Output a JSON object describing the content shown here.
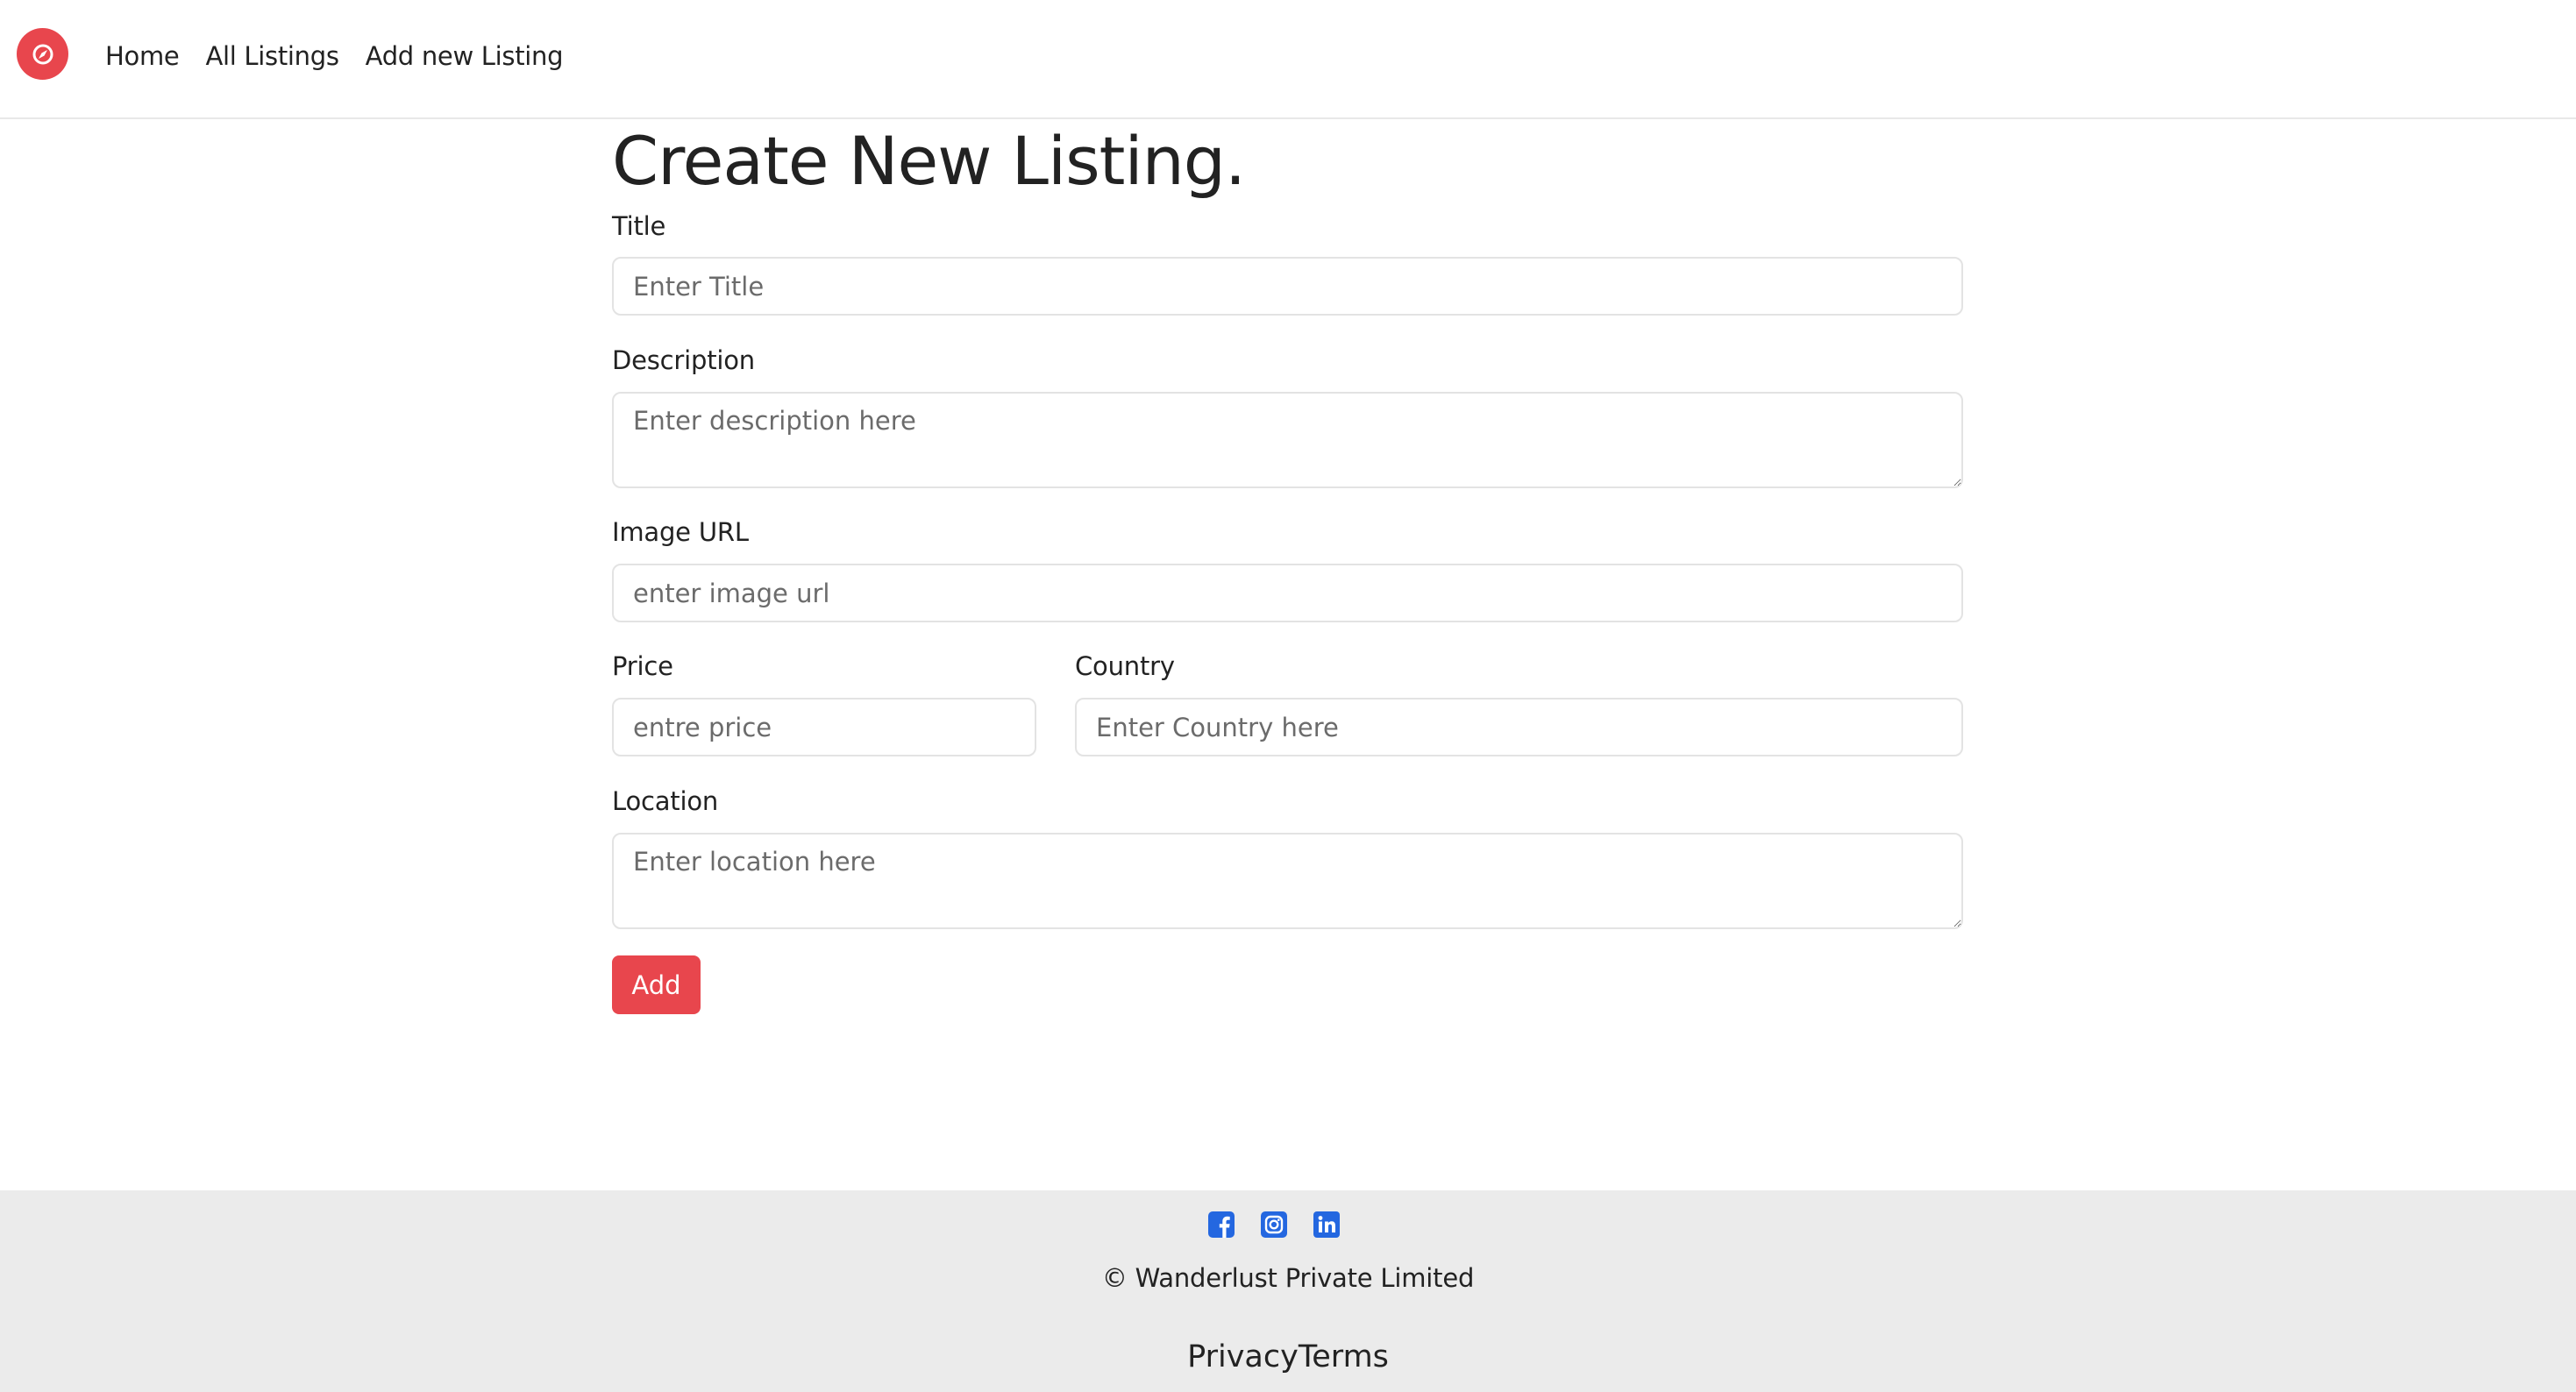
{
  "nav": {
    "logo_icon": "compass-icon",
    "links": [
      {
        "label": "Home"
      },
      {
        "label": "All Listings"
      },
      {
        "label": "Add new Listing"
      }
    ]
  },
  "form": {
    "title": "Create New Listing.",
    "fields": {
      "title": {
        "label": "Title",
        "placeholder": "Enter Title",
        "value": ""
      },
      "description": {
        "label": "Description",
        "placeholder": "Enter description here",
        "value": ""
      },
      "image_url": {
        "label": "Image URL",
        "placeholder": "enter image url",
        "value": ""
      },
      "price": {
        "label": "Price",
        "placeholder": "entre price",
        "value": ""
      },
      "country": {
        "label": "Country",
        "placeholder": "Enter Country here",
        "value": ""
      },
      "location": {
        "label": "Location",
        "placeholder": "Enter location here",
        "value": ""
      }
    },
    "submit_label": "Add"
  },
  "footer": {
    "social_icons": [
      "facebook-icon",
      "instagram-icon",
      "linkedin-icon"
    ],
    "copyright": "© Wanderlust Private Limited",
    "links": [
      "Privacy",
      "Terms"
    ]
  },
  "colors": {
    "accent": "#e8464d",
    "social": "#2467e0",
    "footer_bg": "#ebebeb"
  }
}
